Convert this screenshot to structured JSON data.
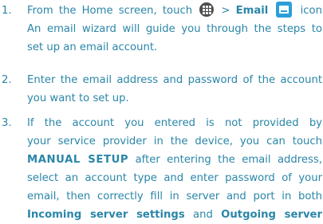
{
  "steps": [
    {
      "number": "1.",
      "lines": [
        {
          "before": "From the Home screen, touch",
          "sep": ">",
          "bold": "Email",
          "after": "icon"
        },
        "An email wizard will guide you through the steps to",
        "set up an email account."
      ],
      "icons": [
        "apps-icon",
        "email-icon"
      ]
    },
    {
      "number": "2.",
      "lines": [
        "Enter the email address and password of the account",
        "you want to set up."
      ]
    },
    {
      "number": "3.",
      "lines": [
        "If the account you entered is not provided by",
        "your service provider in the device, you can touch",
        {
          "bold": "MANUAL SETUP",
          "after": "after entering the email address,"
        },
        "select an account type and enter password of your",
        "email, then correctly fill in server and port in both",
        {
          "bold1": "Incoming server settings",
          "mid": "and",
          "bold2": "Outgoing server"
        }
      ]
    }
  ],
  "colors": {
    "text": "#2a86a8",
    "email_icon": "#2a9fd8",
    "apps_icon": "#4e4e4e"
  }
}
